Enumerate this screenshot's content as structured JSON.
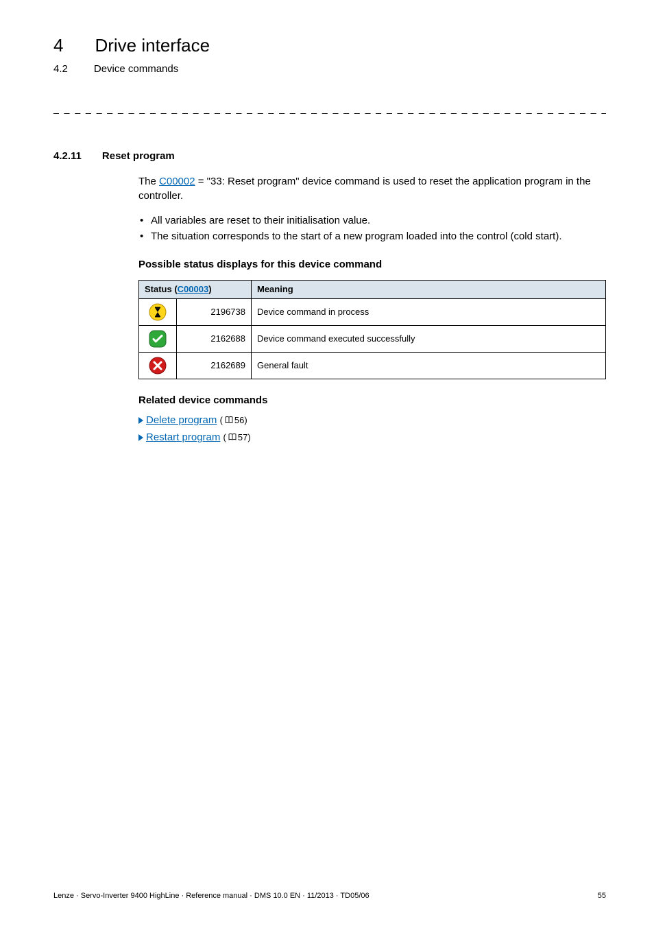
{
  "header": {
    "chapter_num": "4",
    "chapter_title": "Drive interface",
    "section_num": "4.2",
    "section_title": "Device commands"
  },
  "dashes": "_ _ _ _ _ _ _ _ _ _ _ _ _ _ _ _ _ _ _ _ _ _ _ _ _ _ _ _ _ _ _ _ _ _ _ _ _ _ _ _ _ _ _ _ _ _ _ _ _ _ _ _ _ _ _ _ _ _ _ _ _ _ _ _",
  "section": {
    "num": "4.2.11",
    "title": "Reset program"
  },
  "intro": {
    "prefix": "The ",
    "link": "C00002",
    "suffix": " = \"33: Reset program\" device command is used to reset the application program in the controller."
  },
  "bullets": [
    "All variables are reset to their initialisation value.",
    "The situation corresponds to the start of a new program loaded into the control (cold start)."
  ],
  "status_heading": "Possible status displays for this device command",
  "table": {
    "head_status_prefix": "Status (",
    "head_status_link": "C00003",
    "head_status_suffix": ")",
    "head_meaning": "Meaning",
    "rows": [
      {
        "icon": "hourglass",
        "code": "2196738",
        "meaning": "Device command in process"
      },
      {
        "icon": "check",
        "code": "2162688",
        "meaning": "Device command executed successfully"
      },
      {
        "icon": "cross",
        "code": "2162689",
        "meaning": "General fault"
      }
    ]
  },
  "related_heading": "Related device commands",
  "related": [
    {
      "label": "Delete program",
      "page": "56"
    },
    {
      "label": "Restart program",
      "page": "57"
    }
  ],
  "footer": {
    "left": "Lenze · Servo-Inverter 9400 HighLine · Reference manual · DMS 10.0 EN · 11/2013 · TD05/06",
    "right": "55"
  }
}
